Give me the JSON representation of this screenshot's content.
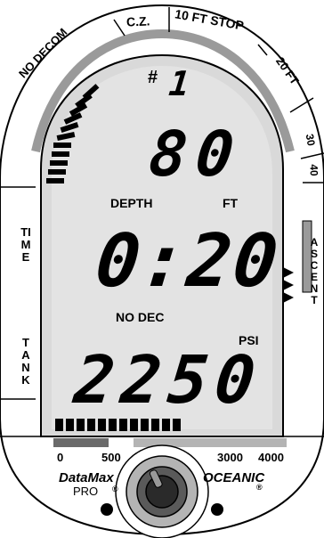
{
  "zones": {
    "no_decom": "NO DECOM",
    "cz": "C.Z.",
    "stop_10ft": "10 FT  STOP",
    "ft20": "20 FT",
    "ft30": "30",
    "ft40": "40"
  },
  "dive": {
    "number_symbol": "#",
    "number": "1",
    "depth_value": "80",
    "depth_label": "DEPTH",
    "depth_unit": "FT",
    "time_value": "0:20",
    "status": "NO DEC",
    "psi_label": "PSI",
    "tank_value": "2250"
  },
  "side_labels": {
    "time": "TIME",
    "tank": "TANK",
    "ascent": "ASCENT"
  },
  "scale": {
    "t0": "0",
    "t500": "500",
    "t3000": "3000",
    "t4000": "4000"
  },
  "brand": {
    "model": "DataMax",
    "model_sub": "PRO",
    "maker": "OCEANIC",
    "reg_mark": "®"
  }
}
